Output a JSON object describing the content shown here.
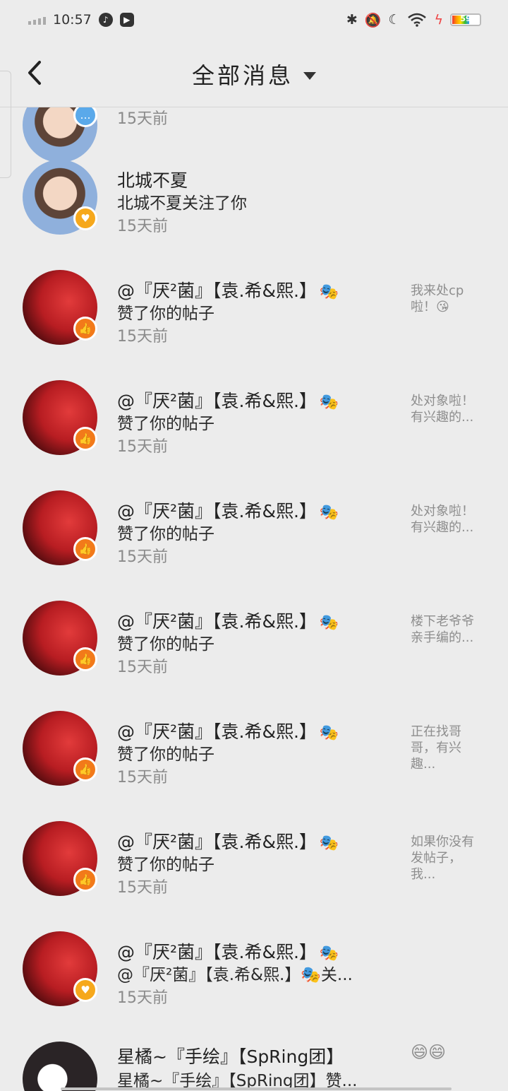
{
  "status_bar": {
    "time": "10:57",
    "battery_level": "59"
  },
  "header": {
    "title": "全部消息"
  },
  "partial_top": {
    "time": "15天前"
  },
  "items": [
    {
      "name": "北城不夏",
      "action": "北城不夏关注了你",
      "time": "15天前",
      "preview": ""
    },
    {
      "name": "@『厌²菌』【袁.希&熙.】",
      "action": "赞了你的帖子",
      "time": "15天前",
      "preview": "我来处cp啦！😘"
    },
    {
      "name": "@『厌²菌』【袁.希&熙.】",
      "action": "赞了你的帖子",
      "time": "15天前",
      "preview": "处对象啦！有兴趣的..."
    },
    {
      "name": "@『厌²菌』【袁.希&熙.】",
      "action": "赞了你的帖子",
      "time": "15天前",
      "preview": "处对象啦！有兴趣的..."
    },
    {
      "name": "@『厌²菌』【袁.希&熙.】",
      "action": "赞了你的帖子",
      "time": "15天前",
      "preview": "楼下老爷爷亲手编的..."
    },
    {
      "name": "@『厌²菌』【袁.希&熙.】",
      "action": "赞了你的帖子",
      "time": "15天前",
      "preview": "正在找哥哥，有兴趣..."
    },
    {
      "name": "@『厌²菌』【袁.希&熙.】",
      "action": "赞了你的帖子",
      "time": "15天前",
      "preview": "如果你没有发帖子，我..."
    },
    {
      "name": "@『厌²菌』【袁.希&熙.】",
      "action": "@『厌²菌』【袁.希&熙.】🎭关...",
      "time": "15天前",
      "preview": ""
    },
    {
      "name": "星橘~『手绘』【SpRing团】",
      "action": "星橘~『手绘』【SpRing团】赞...",
      "time": "",
      "preview": "😄😄"
    }
  ],
  "icons": {
    "back": "chevron-left-icon",
    "dropdown": "caret-down-icon",
    "like_badge": "thumbs-up-icon",
    "follow_badge": "heart-icon",
    "message_badge": "chat-bubble-icon",
    "mask": "theater-masks-icon"
  },
  "colors": {
    "like_badge": "#f27a1a",
    "follow_badge": "#f6a81c",
    "message_badge": "#5aa9ea"
  }
}
